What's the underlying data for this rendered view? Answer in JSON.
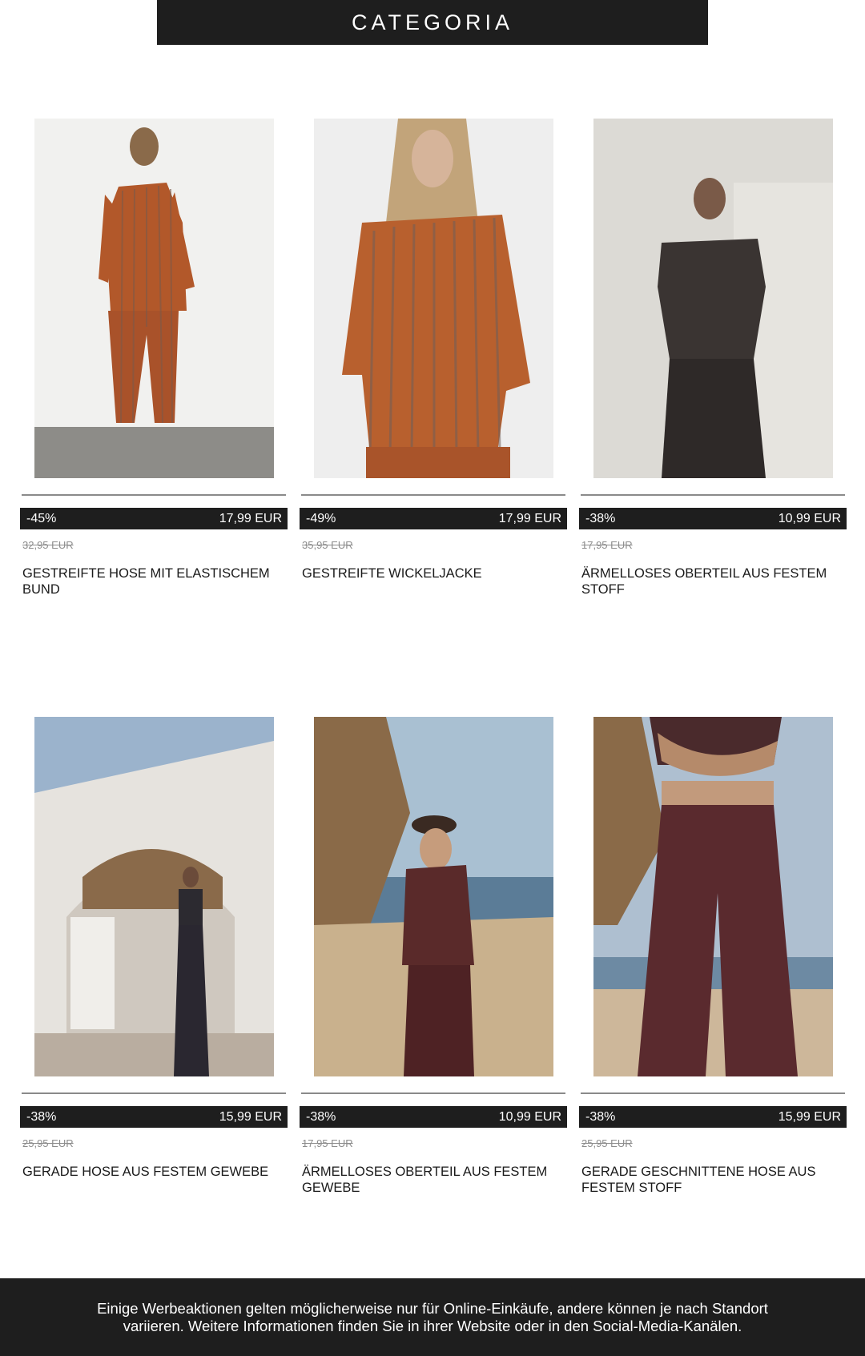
{
  "header": {
    "title": "CATEGORIA"
  },
  "products": [
    {
      "discount": "-45%",
      "price": "17,99 EUR",
      "old_price": "32,95 EUR",
      "name": "GESTREIFTE HOSE MIT ELASTISCHEM BUND"
    },
    {
      "discount": "-49%",
      "price": "17,99 EUR",
      "old_price": "35,95 EUR",
      "name": "GESTREIFTE WICKELJACKE"
    },
    {
      "discount": "-38%",
      "price": "10,99 EUR",
      "old_price": "17,95 EUR",
      "name": "ÄRMELLOSES OBERTEIL AUS FESTEM STOFF"
    },
    {
      "discount": "-38%",
      "price": "15,99 EUR",
      "old_price": "25,95 EUR",
      "name": "GERADE HOSE AUS FESTEM GEWEBE"
    },
    {
      "discount": "-38%",
      "price": "10,99 EUR",
      "old_price": "17,95 EUR",
      "name": "ÄRMELLOSES OBERTEIL AUS FESTEM GEWEBE"
    },
    {
      "discount": "-38%",
      "price": "15,99 EUR",
      "old_price": "25,95 EUR",
      "name": "GERADE GESCHNITTENE HOSE AUS FESTEM STOFF"
    }
  ],
  "footer": {
    "text": "Einige Werbeaktionen gelten möglicherweise nur für Online-Einkäufe, andere können je nach Standort variieren. Weitere Informationen finden Sie in ihrer Website oder in den Social-Media-Kanälen."
  },
  "colors": {
    "bar": "#1e1e1e",
    "text": "#1d1d1d",
    "old_price": "#8c8c8c"
  }
}
